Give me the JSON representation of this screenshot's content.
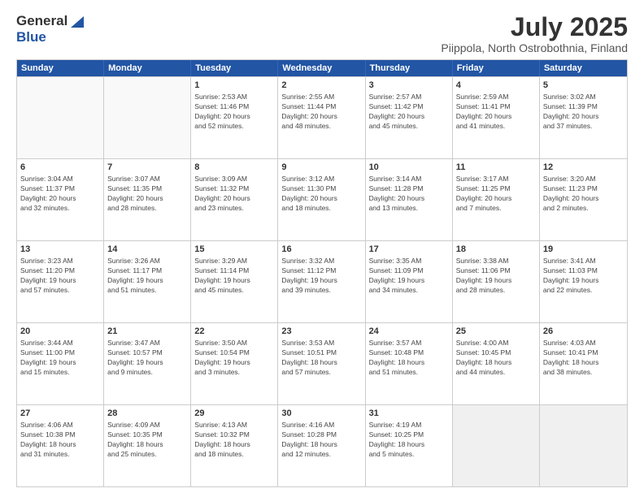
{
  "header": {
    "logo_general": "General",
    "logo_blue": "Blue",
    "title": "July 2025",
    "location": "Piippola, North Ostrobothnia, Finland"
  },
  "calendar": {
    "days": [
      "Sunday",
      "Monday",
      "Tuesday",
      "Wednesday",
      "Thursday",
      "Friday",
      "Saturday"
    ],
    "weeks": [
      [
        {
          "day": "",
          "content": ""
        },
        {
          "day": "",
          "content": ""
        },
        {
          "day": "1",
          "content": "Sunrise: 2:53 AM\nSunset: 11:46 PM\nDaylight: 20 hours\nand 52 minutes."
        },
        {
          "day": "2",
          "content": "Sunrise: 2:55 AM\nSunset: 11:44 PM\nDaylight: 20 hours\nand 48 minutes."
        },
        {
          "day": "3",
          "content": "Sunrise: 2:57 AM\nSunset: 11:42 PM\nDaylight: 20 hours\nand 45 minutes."
        },
        {
          "day": "4",
          "content": "Sunrise: 2:59 AM\nSunset: 11:41 PM\nDaylight: 20 hours\nand 41 minutes."
        },
        {
          "day": "5",
          "content": "Sunrise: 3:02 AM\nSunset: 11:39 PM\nDaylight: 20 hours\nand 37 minutes."
        }
      ],
      [
        {
          "day": "6",
          "content": "Sunrise: 3:04 AM\nSunset: 11:37 PM\nDaylight: 20 hours\nand 32 minutes."
        },
        {
          "day": "7",
          "content": "Sunrise: 3:07 AM\nSunset: 11:35 PM\nDaylight: 20 hours\nand 28 minutes."
        },
        {
          "day": "8",
          "content": "Sunrise: 3:09 AM\nSunset: 11:32 PM\nDaylight: 20 hours\nand 23 minutes."
        },
        {
          "day": "9",
          "content": "Sunrise: 3:12 AM\nSunset: 11:30 PM\nDaylight: 20 hours\nand 18 minutes."
        },
        {
          "day": "10",
          "content": "Sunrise: 3:14 AM\nSunset: 11:28 PM\nDaylight: 20 hours\nand 13 minutes."
        },
        {
          "day": "11",
          "content": "Sunrise: 3:17 AM\nSunset: 11:25 PM\nDaylight: 20 hours\nand 7 minutes."
        },
        {
          "day": "12",
          "content": "Sunrise: 3:20 AM\nSunset: 11:23 PM\nDaylight: 20 hours\nand 2 minutes."
        }
      ],
      [
        {
          "day": "13",
          "content": "Sunrise: 3:23 AM\nSunset: 11:20 PM\nDaylight: 19 hours\nand 57 minutes."
        },
        {
          "day": "14",
          "content": "Sunrise: 3:26 AM\nSunset: 11:17 PM\nDaylight: 19 hours\nand 51 minutes."
        },
        {
          "day": "15",
          "content": "Sunrise: 3:29 AM\nSunset: 11:14 PM\nDaylight: 19 hours\nand 45 minutes."
        },
        {
          "day": "16",
          "content": "Sunrise: 3:32 AM\nSunset: 11:12 PM\nDaylight: 19 hours\nand 39 minutes."
        },
        {
          "day": "17",
          "content": "Sunrise: 3:35 AM\nSunset: 11:09 PM\nDaylight: 19 hours\nand 34 minutes."
        },
        {
          "day": "18",
          "content": "Sunrise: 3:38 AM\nSunset: 11:06 PM\nDaylight: 19 hours\nand 28 minutes."
        },
        {
          "day": "19",
          "content": "Sunrise: 3:41 AM\nSunset: 11:03 PM\nDaylight: 19 hours\nand 22 minutes."
        }
      ],
      [
        {
          "day": "20",
          "content": "Sunrise: 3:44 AM\nSunset: 11:00 PM\nDaylight: 19 hours\nand 15 minutes."
        },
        {
          "day": "21",
          "content": "Sunrise: 3:47 AM\nSunset: 10:57 PM\nDaylight: 19 hours\nand 9 minutes."
        },
        {
          "day": "22",
          "content": "Sunrise: 3:50 AM\nSunset: 10:54 PM\nDaylight: 19 hours\nand 3 minutes."
        },
        {
          "day": "23",
          "content": "Sunrise: 3:53 AM\nSunset: 10:51 PM\nDaylight: 18 hours\nand 57 minutes."
        },
        {
          "day": "24",
          "content": "Sunrise: 3:57 AM\nSunset: 10:48 PM\nDaylight: 18 hours\nand 51 minutes."
        },
        {
          "day": "25",
          "content": "Sunrise: 4:00 AM\nSunset: 10:45 PM\nDaylight: 18 hours\nand 44 minutes."
        },
        {
          "day": "26",
          "content": "Sunrise: 4:03 AM\nSunset: 10:41 PM\nDaylight: 18 hours\nand 38 minutes."
        }
      ],
      [
        {
          "day": "27",
          "content": "Sunrise: 4:06 AM\nSunset: 10:38 PM\nDaylight: 18 hours\nand 31 minutes."
        },
        {
          "day": "28",
          "content": "Sunrise: 4:09 AM\nSunset: 10:35 PM\nDaylight: 18 hours\nand 25 minutes."
        },
        {
          "day": "29",
          "content": "Sunrise: 4:13 AM\nSunset: 10:32 PM\nDaylight: 18 hours\nand 18 minutes."
        },
        {
          "day": "30",
          "content": "Sunrise: 4:16 AM\nSunset: 10:28 PM\nDaylight: 18 hours\nand 12 minutes."
        },
        {
          "day": "31",
          "content": "Sunrise: 4:19 AM\nSunset: 10:25 PM\nDaylight: 18 hours\nand 5 minutes."
        },
        {
          "day": "",
          "content": ""
        },
        {
          "day": "",
          "content": ""
        }
      ]
    ]
  }
}
